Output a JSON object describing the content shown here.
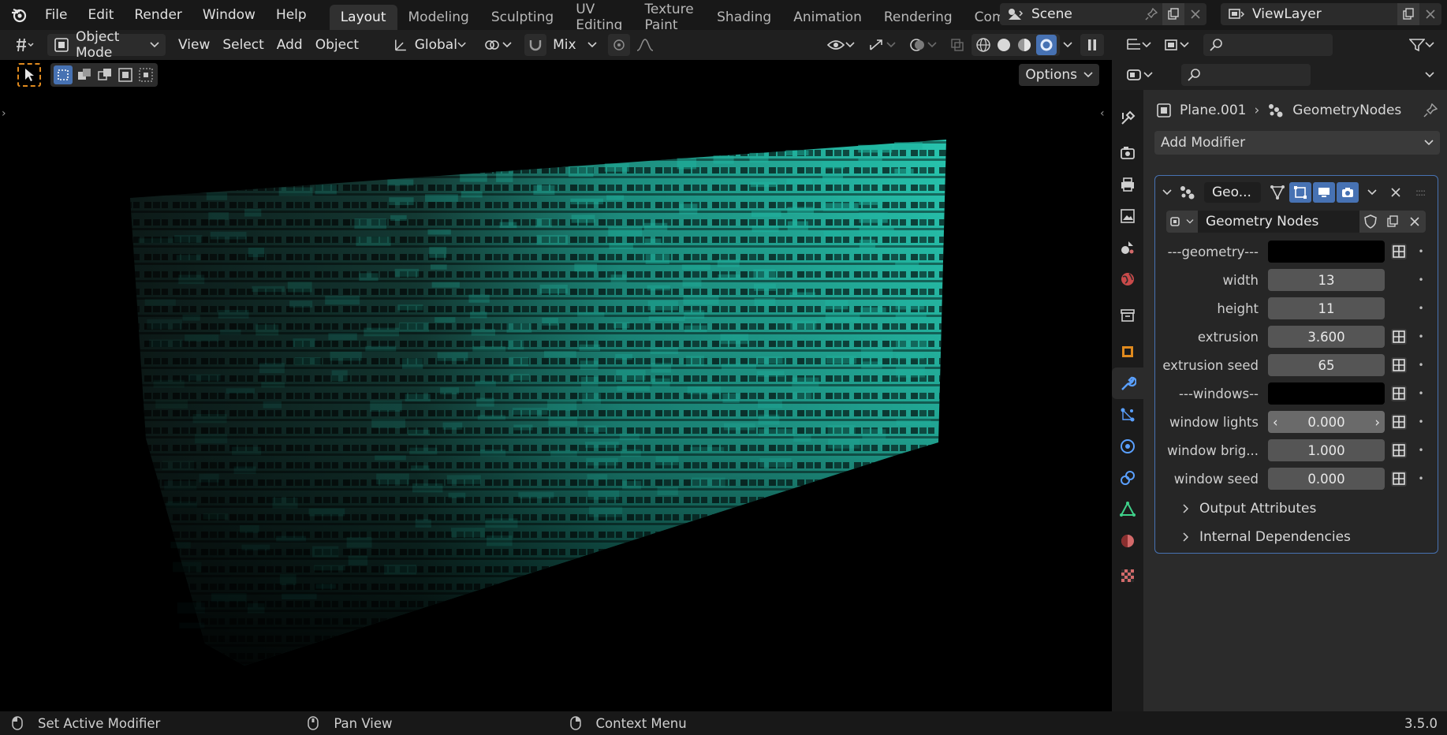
{
  "topbar": {
    "menus": [
      "File",
      "Edit",
      "Render",
      "Window",
      "Help"
    ],
    "workspaces": [
      "Layout",
      "Modeling",
      "Sculpting",
      "UV Editing",
      "Texture Paint",
      "Shading",
      "Animation",
      "Rendering",
      "Compo"
    ],
    "active_workspace": "Layout",
    "scene": "Scene",
    "view_layer": "ViewLayer"
  },
  "header": {
    "mode": "Object Mode",
    "menus": [
      "View",
      "Select",
      "Add",
      "Object"
    ],
    "orientation": "Global",
    "snap_mode": "Mix",
    "options": "Options"
  },
  "properties": {
    "breadcrumb_object": "Plane.001",
    "breadcrumb_modifier": "GeometryNodes",
    "add_modifier": "Add Modifier",
    "modifier_name": "Geo...",
    "node_group": "Geometry Nodes",
    "inputs": [
      {
        "label": "---geometry---",
        "value": ""
      },
      {
        "label": "width",
        "value": "13"
      },
      {
        "label": "height",
        "value": "11"
      },
      {
        "label": "extrusion",
        "value": "3.600"
      },
      {
        "label": "extrusion seed",
        "value": "65"
      },
      {
        "label": "---windows--",
        "value": ""
      },
      {
        "label": "window lights",
        "value": "0.000"
      },
      {
        "label": "window brig...",
        "value": "1.000"
      },
      {
        "label": "window seed",
        "value": "0.000"
      }
    ],
    "output_attributes": "Output Attributes",
    "internal_dependencies": "Internal Dependencies"
  },
  "status": {
    "left_action": "Set Active Modifier",
    "middle_action": "Pan View",
    "right_action": "Context Menu",
    "version": "3.5.0"
  },
  "colors": {
    "accent": "#4772b3",
    "building": "#1fb6a1"
  }
}
